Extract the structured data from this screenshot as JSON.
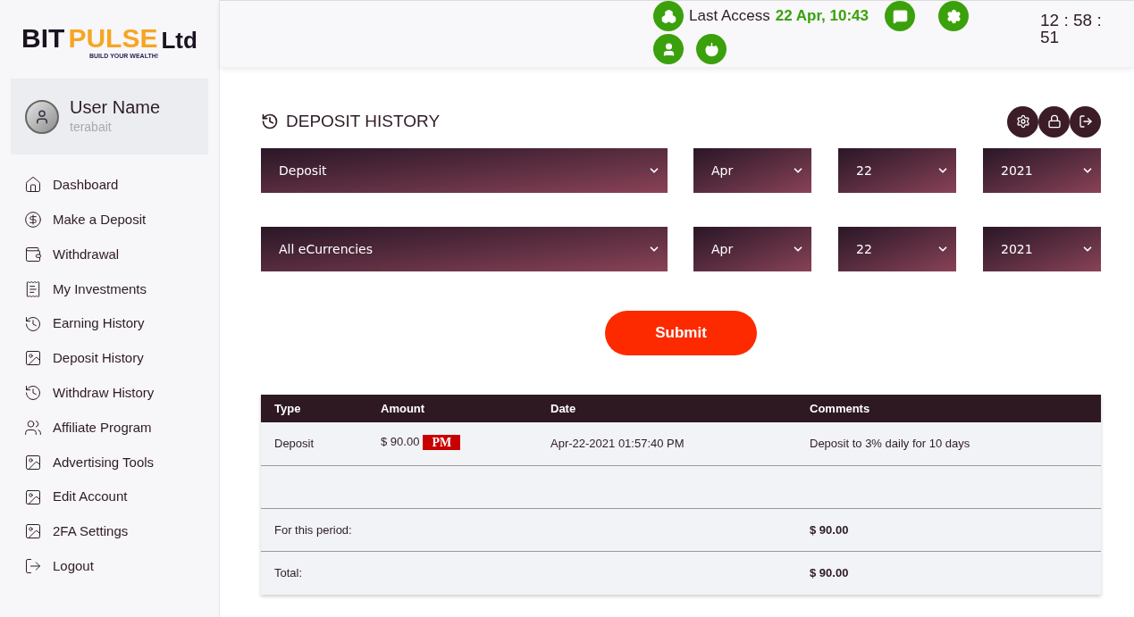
{
  "logo": {
    "word_1": "BIT",
    "word_2": "PULSE",
    "word_3": "Ltd",
    "tagline": "BUILD YOUR WEALTH!"
  },
  "user": {
    "name": "User Name",
    "login": "terabait"
  },
  "sidebar": {
    "items": [
      {
        "label": "Dashboard"
      },
      {
        "label": "Make a Deposit"
      },
      {
        "label": "Withdrawal"
      },
      {
        "label": "My Investments"
      },
      {
        "label": "Earning History"
      },
      {
        "label": "Deposit History"
      },
      {
        "label": "Withdraw History"
      },
      {
        "label": "Affiliate Program"
      },
      {
        "label": "Advertising Tools"
      },
      {
        "label": "Edit Account"
      },
      {
        "label": "2FA Settings"
      },
      {
        "label": "Logout"
      }
    ]
  },
  "header": {
    "last_access_label": "Last Access",
    "last_access_value": "22 Apr, 10:43",
    "clock": "12 : 58 : 51"
  },
  "page": {
    "title": "DEPOSIT HISTORY"
  },
  "filters": [
    {
      "type": "Deposit",
      "month": "Apr",
      "day": "22",
      "year": "2021"
    },
    {
      "type": "All eCurrencies",
      "month": "Apr",
      "day": "22",
      "year": "2021"
    }
  ],
  "submit": "Submit",
  "table": {
    "columns": [
      "Type",
      "Amount",
      "Date",
      "Comments"
    ],
    "rows": [
      {
        "type": "Deposit",
        "amount": "$ 90.00",
        "currency": "PM",
        "date": "Apr-22-2021 01:57:40 PM",
        "comment": "Deposit to 3% daily for 10 days"
      }
    ],
    "summary": [
      {
        "label": "For this period:",
        "value": "$ 90.00"
      },
      {
        "label": "Total:",
        "value": "$ 90.00"
      }
    ]
  }
}
